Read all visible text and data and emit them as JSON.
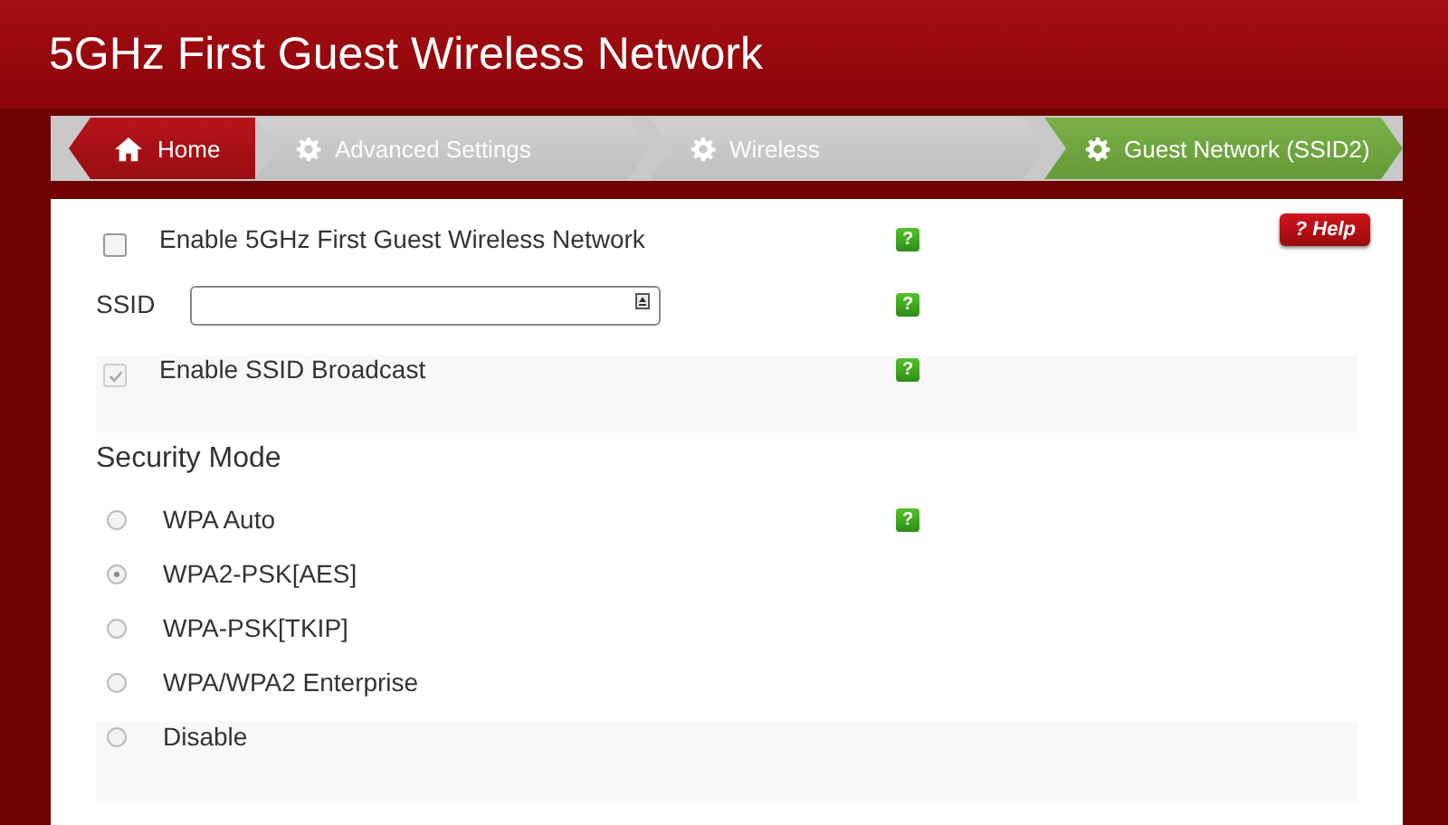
{
  "title": "5GHz First Guest Wireless Network",
  "breadcrumb": [
    {
      "label": "Home",
      "kind": "home",
      "selected": false
    },
    {
      "label": "Advanced Settings",
      "kind": "gear",
      "selected": false
    },
    {
      "label": "Wireless",
      "kind": "gear",
      "selected": false
    },
    {
      "label": "Guest Network (SSID2)",
      "kind": "gear",
      "selected": true
    }
  ],
  "help_button": "? Help",
  "settings": [
    {
      "kind": "checkbox",
      "label": "Enable 5GHz First Guest Wireless Network",
      "checked": false,
      "disabled": false,
      "shaded": false,
      "hint": "?"
    },
    {
      "kind": "field",
      "label": "SSID",
      "shaded": false,
      "hint": "?"
    },
    {
      "kind": "checkbox",
      "label": "Enable SSID Broadcast",
      "checked": true,
      "disabled": true,
      "shaded": true,
      "hint": "?"
    }
  ],
  "security_mode": {
    "heading": "Security Mode",
    "options": [
      {
        "label": "WPA Auto",
        "selected": false,
        "shaded": false,
        "hint": "?"
      },
      {
        "label": "WPA2-PSK[AES]",
        "selected": true,
        "shaded": false
      },
      {
        "label": "WPA-PSK[TKIP]",
        "selected": false,
        "shaded": false
      },
      {
        "label": "WPA/WPA2 Enterprise",
        "selected": false,
        "shaded": false
      },
      {
        "label": "Disable",
        "selected": false,
        "shaded": true
      }
    ]
  }
}
